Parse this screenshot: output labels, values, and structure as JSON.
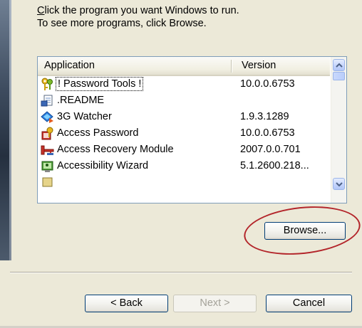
{
  "instructions": {
    "line1": "Click the program you want Windows to run.",
    "line1_hotkey_char": "C",
    "line1_rest": "lick the program you want Windows to run.",
    "line2": "To see more programs, click Browse."
  },
  "list": {
    "columns": {
      "application": "Application",
      "version": "Version"
    },
    "rows": [
      {
        "name": "! Password Tools !",
        "version": "10.0.0.6753",
        "icon": "keys-icon",
        "focused": true
      },
      {
        "name": ".README",
        "version": "",
        "icon": "document-icon"
      },
      {
        "name": "3G Watcher",
        "version": "1.9.3.1289",
        "icon": "diamond-arrow-icon"
      },
      {
        "name": "Access Password",
        "version": "10.0.0.6753",
        "icon": "key-document-icon"
      },
      {
        "name": "Access Recovery Module",
        "version": "2007.0.0.701",
        "icon": "key-red-icon"
      },
      {
        "name": "Accessibility Wizard",
        "version": "5.1.2600.218...",
        "icon": "accessibility-wizard-icon"
      }
    ]
  },
  "buttons": {
    "browse": "Browse...",
    "back": "< Back",
    "next": "Next >",
    "cancel": "Cancel"
  },
  "colors": {
    "dialog_bg": "#ece9d8",
    "annotation_ellipse": "#b3252a",
    "button_border": "#003c74"
  }
}
